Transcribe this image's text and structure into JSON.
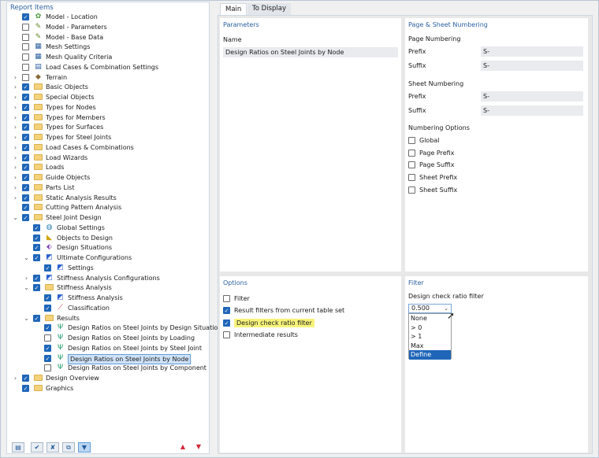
{
  "left_panel": {
    "title": "Report Items",
    "tree": [
      {
        "label": "Model - Location",
        "icon": "location-map-icon",
        "checked": true,
        "expander": ""
      },
      {
        "label": "Model - Parameters",
        "icon": "model-parameters-icon",
        "checked": false,
        "expander": ""
      },
      {
        "label": "Model - Base Data",
        "icon": "base-data-icon",
        "checked": false,
        "expander": ""
      },
      {
        "label": "Mesh Settings",
        "icon": "mesh-settings-icon",
        "checked": false,
        "expander": ""
      },
      {
        "label": "Mesh Quality Criteria",
        "icon": "mesh-quality-icon",
        "checked": false,
        "expander": ""
      },
      {
        "label": "Load Cases & Combination Settings",
        "icon": "load-settings-icon",
        "checked": false,
        "expander": ""
      },
      {
        "label": "Terrain",
        "icon": "terrain-icon",
        "checked": false,
        "expander": ">"
      },
      {
        "label": "Basic Objects",
        "icon": "folder-icon",
        "checked": true,
        "expander": ">"
      },
      {
        "label": "Special Objects",
        "icon": "folder-icon",
        "checked": true,
        "expander": ">"
      },
      {
        "label": "Types for Nodes",
        "icon": "folder-icon",
        "checked": true,
        "expander": ">"
      },
      {
        "label": "Types for Members",
        "icon": "folder-icon",
        "checked": true,
        "expander": ">"
      },
      {
        "label": "Types for Surfaces",
        "icon": "folder-icon",
        "checked": true,
        "expander": ">"
      },
      {
        "label": "Types for Steel Joints",
        "icon": "folder-icon",
        "checked": true,
        "expander": ">"
      },
      {
        "label": "Load Cases & Combinations",
        "icon": "folder-icon",
        "checked": true,
        "expander": ">"
      },
      {
        "label": "Load Wizards",
        "icon": "folder-icon",
        "checked": true,
        "expander": ">"
      },
      {
        "label": "Loads",
        "icon": "folder-icon",
        "checked": true,
        "expander": ">"
      },
      {
        "label": "Guide Objects",
        "icon": "folder-icon",
        "checked": true,
        "expander": ">"
      },
      {
        "label": "Parts List",
        "icon": "folder-icon",
        "checked": true,
        "expander": ">"
      },
      {
        "label": "Static Analysis Results",
        "icon": "folder-icon",
        "checked": true,
        "expander": ">"
      },
      {
        "label": "Cutting Pattern Analysis",
        "icon": "folder-icon",
        "checked": true,
        "expander": ""
      },
      {
        "label": "Steel Joint Design",
        "icon": "folder-icon",
        "checked": true,
        "expander": "v"
      },
      {
        "label": "Global Settings",
        "icon": "globe-icon",
        "checked": true,
        "expander": ""
      },
      {
        "label": "Objects to Design",
        "icon": "objects-to-design-icon",
        "checked": true,
        "expander": ""
      },
      {
        "label": "Design Situations",
        "icon": "design-situations-icon",
        "checked": true,
        "expander": ""
      },
      {
        "label": "Ultimate Configurations",
        "icon": "configuration-icon",
        "checked": true,
        "expander": "v"
      },
      {
        "label": "Settings",
        "icon": "configuration-icon",
        "checked": true,
        "expander": ""
      },
      {
        "label": "Stiffness Analysis Configurations",
        "icon": "configuration-icon",
        "checked": true,
        "expander": ">"
      },
      {
        "label": "Stiffness Analysis",
        "icon": "folder-icon",
        "checked": true,
        "expander": "v"
      },
      {
        "label": "Stiffness Analysis",
        "icon": "configuration-icon",
        "checked": true,
        "expander": ""
      },
      {
        "label": "Classification",
        "icon": "classification-icon",
        "checked": true,
        "expander": ""
      },
      {
        "label": "Results",
        "icon": "folder-icon",
        "checked": true,
        "expander": "v"
      },
      {
        "label": "Design Ratios on Steel Joints by Design Situation",
        "icon": "design-ratio-icon",
        "checked": true,
        "expander": ""
      },
      {
        "label": "Design Ratios on Steel Joints by Loading",
        "icon": "design-ratio-icon",
        "checked": false,
        "expander": ""
      },
      {
        "label": "Design Ratios on Steel Joints by Steel Joint",
        "icon": "design-ratio-icon",
        "checked": true,
        "expander": ""
      },
      {
        "label": "Design Ratios on Steel Joints by Node",
        "icon": "design-ratio-icon",
        "checked": true,
        "expander": ""
      },
      {
        "label": "Design Ratios on Steel Joints by Component",
        "icon": "design-ratio-icon",
        "checked": false,
        "expander": ""
      },
      {
        "label": "Design Overview",
        "icon": "folder-icon",
        "checked": true,
        "expander": ">"
      },
      {
        "label": "Graphics",
        "icon": "folder-icon",
        "checked": true,
        "expander": ""
      }
    ],
    "toolbar": {
      "arrow_up": "▲",
      "arrow_down": "▼"
    }
  },
  "tabs": [
    {
      "label": "Main",
      "active": true
    },
    {
      "label": "To Display",
      "active": false
    }
  ],
  "parameters": {
    "title": "Parameters",
    "name_label": "Name",
    "name_value": "Design Ratios on Steel Joints by Node"
  },
  "numbering": {
    "title": "Page & Sheet Numbering",
    "page_heading": "Page Numbering",
    "page_prefix_label": "Prefix",
    "page_prefix_value": "S-",
    "page_suffix_label": "Suffix",
    "page_suffix_value": "S-",
    "sheet_heading": "Sheet Numbering",
    "sheet_prefix_label": "Prefix",
    "sheet_prefix_value": "S-",
    "sheet_suffix_label": "Suffix",
    "sheet_suffix_value": "S-",
    "options_heading": "Numbering Options",
    "options": [
      {
        "label": "Global",
        "checked": false
      },
      {
        "label": "Page Prefix",
        "checked": false
      },
      {
        "label": "Page Suffix",
        "checked": false
      },
      {
        "label": "Sheet Prefix",
        "checked": false
      },
      {
        "label": "Sheet Suffix",
        "checked": false
      }
    ]
  },
  "options": {
    "title": "Options",
    "items": [
      {
        "label": "Filter",
        "checked": false
      },
      {
        "label": "Result filters from current table set",
        "checked": true
      },
      {
        "label": "Design check ratio filter",
        "checked": true
      },
      {
        "label": "Intermediate results",
        "checked": false
      }
    ]
  },
  "filter": {
    "title": "Filter",
    "field_label": "Design check ratio filter",
    "selected_value": "0.500",
    "dropdown_options": [
      "None",
      "> 0",
      "> 1",
      "Max",
      "Define"
    ],
    "highlighted_option": "Define"
  }
}
